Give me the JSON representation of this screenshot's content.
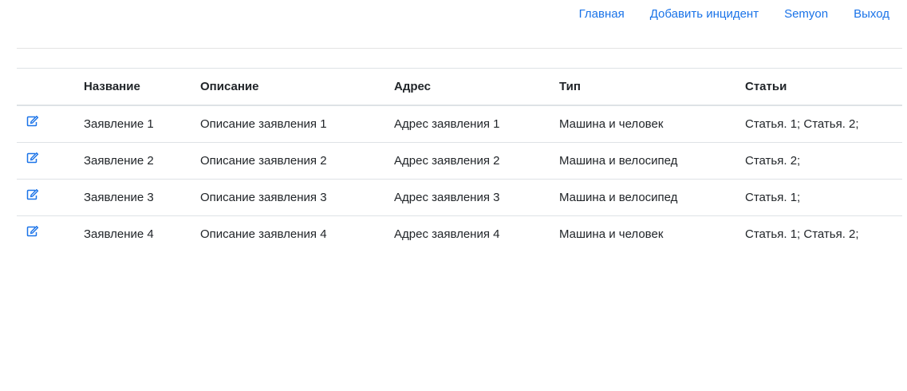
{
  "nav": {
    "home": "Главная",
    "add_incident": "Добавить инцидент",
    "user": "Semyon",
    "logout": "Выход"
  },
  "table": {
    "headers": {
      "name": "Название",
      "description": "Описание",
      "address": "Адрес",
      "type": "Тип",
      "articles": "Статьи"
    },
    "rows": [
      {
        "icon": "edit-icon",
        "name": "Заявление 1",
        "description": "Описание заявления 1",
        "address": "Адрес заявления 1",
        "type": "Машина и человек",
        "articles": "Статья. 1; Статья. 2;"
      },
      {
        "icon": "edit-icon",
        "name": "Заявление 2",
        "description": "Описание заявления 2",
        "address": "Адрес заявления 2",
        "type": "Машина и велосипед",
        "articles": "Статья. 2;"
      },
      {
        "icon": "edit-icon",
        "name": "Заявление 3",
        "description": "Описание заявления 3",
        "address": "Адрес заявления 3",
        "type": "Машина и велосипед",
        "articles": "Статья. 1;"
      },
      {
        "icon": "edit-icon",
        "name": "Заявление 4",
        "description": "Описание заявления 4",
        "address": "Адрес заявления 4",
        "type": "Машина и человек",
        "articles": "Статья. 1; Статья. 2;"
      }
    ]
  },
  "colors": {
    "link": "#1a73e8",
    "text": "#212529",
    "border": "#dee2e6"
  }
}
